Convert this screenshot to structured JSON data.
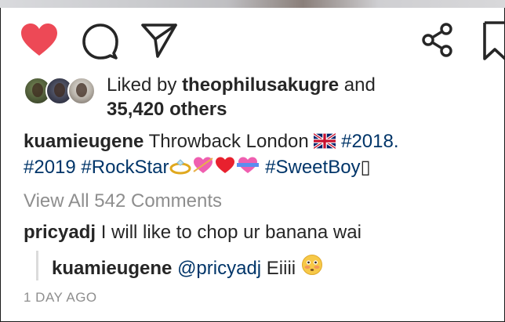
{
  "post": {
    "actions": {
      "like_icon": "heart-filled-icon",
      "comment_icon": "comment-bubble-icon",
      "share_icon": "paper-plane-icon",
      "send_icon": "share-nodes-icon",
      "save_icon": "bookmark-icon",
      "like_color": "#ed4956"
    },
    "likes": {
      "prefix": "Liked by",
      "user": "theophilusakugre",
      "and": "and",
      "others": "35,420 others"
    },
    "caption": {
      "author": "kuamieugene",
      "text": "Throwback London",
      "hashtag_2018": "#2018.",
      "hashtag_2019": "#2019",
      "hashtag_rockstar": "#RockStar",
      "hashtag_sweetboy": "#SweetBoy",
      "trailing_glyph": "▯"
    },
    "view_all_comments": "View All 542 Comments",
    "comments": [
      {
        "user": "pricyadj",
        "text": "I will like to chop ur banana wai"
      }
    ],
    "reply": {
      "user": "kuamieugene",
      "mention": "@pricyadj",
      "text": "Eiiii"
    },
    "timestamp": "1 DAY AGO"
  }
}
